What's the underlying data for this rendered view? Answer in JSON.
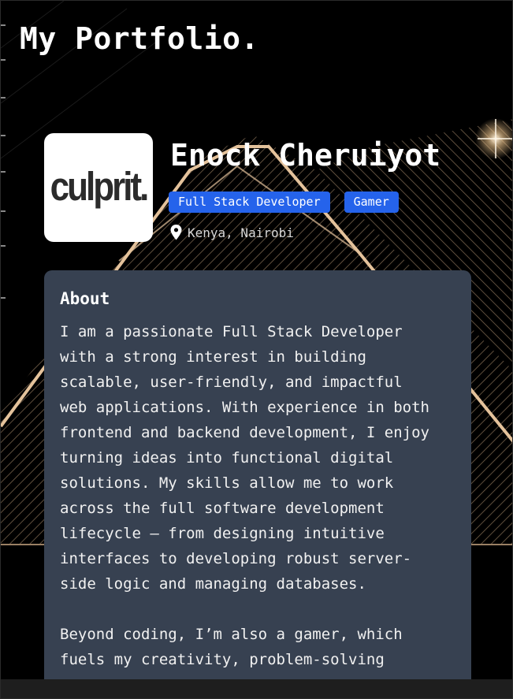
{
  "header": {
    "title": "My Portfolio."
  },
  "profile": {
    "avatar_logo": "culprit.",
    "name": "Enock Cheruiyot",
    "badges": [
      "Full Stack Developer",
      "Gamer"
    ],
    "location": "Kenya, Nairobi",
    "location_icon": "map-pin-icon"
  },
  "about": {
    "heading": "About",
    "paragraphs": [
      "I am a passionate Full Stack Developer\nwith a strong interest in building\nscalable, user-friendly, and impactful\nweb applications. With experience in both\nfrontend and backend development, I enjoy\nturning ideas into functional digital\nsolutions. My skills allow me to work\nacross the full software development\nlifecycle — from designing intuitive\ninterfaces to developing robust server-\nside logic and managing databases.",
      "Beyond coding, I’m also a gamer, which\nfuels my creativity, problem-solving"
    ]
  },
  "colors": {
    "background": "#000000",
    "accent_blue": "#2563eb",
    "card": "#374151",
    "gold_lines": "#d9b48a"
  }
}
